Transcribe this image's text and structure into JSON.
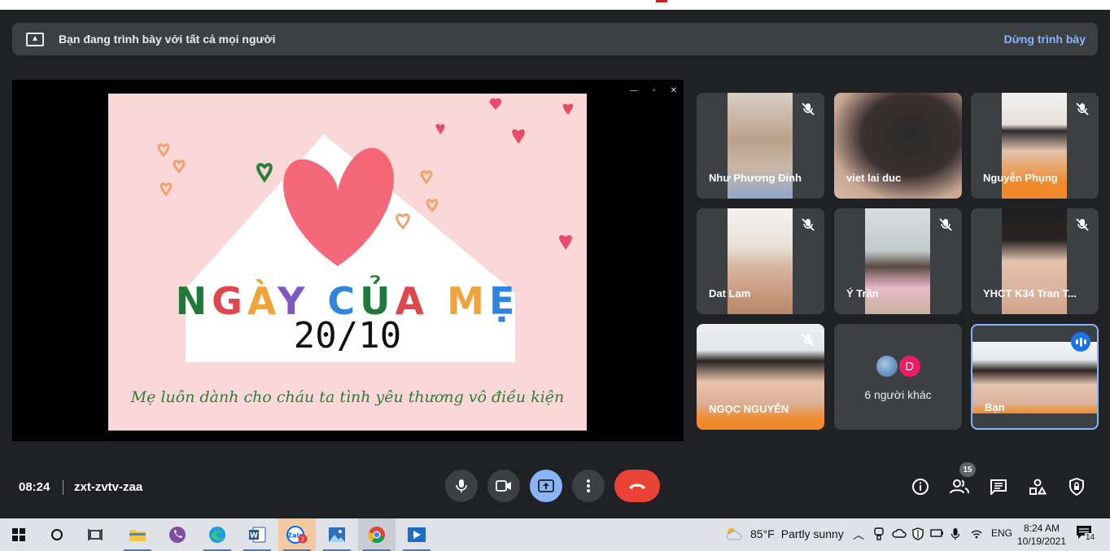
{
  "banner": {
    "message": "Bạn đang trình bày với tất cả mọi người",
    "stop_label": "Dừng trình bày"
  },
  "slide": {
    "title": "NGÀY CỦA MẸ",
    "date": "20/10",
    "tagline": "Mẹ luôn dành cho cháu ta tình yêu thương vô điều kiện"
  },
  "participants": [
    {
      "name": "Như Phương Đinh",
      "muted": true
    },
    {
      "name": "viet lai duc",
      "muted": false
    },
    {
      "name": "Nguyễn Phụng",
      "muted": true
    },
    {
      "name": "Dat Lam",
      "muted": true
    },
    {
      "name": "Ý Trần",
      "muted": true
    },
    {
      "name": "YHCT K34 Tran T...",
      "muted": true
    },
    {
      "name": "NGỌC NGUYỄN",
      "muted": true
    },
    {
      "name": "6 người khác",
      "avatar_letter": "D"
    },
    {
      "name": "Bạn",
      "speaking": true
    }
  ],
  "meeting": {
    "time": "08:24",
    "code": "zxt-zvtv-zaa",
    "people_count": "15"
  },
  "taskbar": {
    "weather_temp": "85°F",
    "weather_desc": "Partly sunny",
    "lang": "ENG",
    "clock_time": "8:24 AM",
    "clock_date": "10/19/2021",
    "notifications": "14",
    "zalo_badge": "2"
  },
  "colors": {
    "accent": "#8ab4f8",
    "hangup": "#ea4335",
    "surface": "#3c4043",
    "background": "#202124"
  }
}
